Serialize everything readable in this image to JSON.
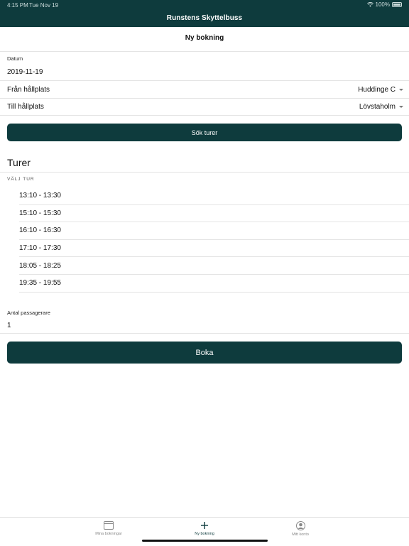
{
  "status": {
    "time": "4:15 PM",
    "date": "Tue Nov 19",
    "battery": "100%"
  },
  "header": {
    "title": "Runstens Skyttelbuss"
  },
  "page": {
    "subtitle": "Ny bokning"
  },
  "form": {
    "date_label": "Datum",
    "date_value": "2019-11-19",
    "from_label": "Från hållplats",
    "from_value": "Huddinge C",
    "to_label": "Till hållplats",
    "to_value": "Lövstaholm",
    "search_button": "Sök turer"
  },
  "tours": {
    "title": "Turer",
    "caption": "VÄLJ TUR",
    "items": [
      "13:10 - 13:30",
      "15:10 - 15:30",
      "16:10 - 16:30",
      "17:10 - 17:30",
      "18:05 - 18:25",
      "19:35 - 19:55"
    ]
  },
  "passengers": {
    "label": "Antal passagerare",
    "value": "1"
  },
  "book_button": "Boka",
  "tabbar": {
    "items": [
      {
        "label": "Mina bokningar",
        "icon": "calendar-icon"
      },
      {
        "label": "Ny bokning",
        "icon": "plus-icon"
      },
      {
        "label": "Mitt konto",
        "icon": "account-icon"
      }
    ]
  },
  "colors": {
    "primary": "#0e3b3d",
    "divider": "#e4e4e4"
  }
}
